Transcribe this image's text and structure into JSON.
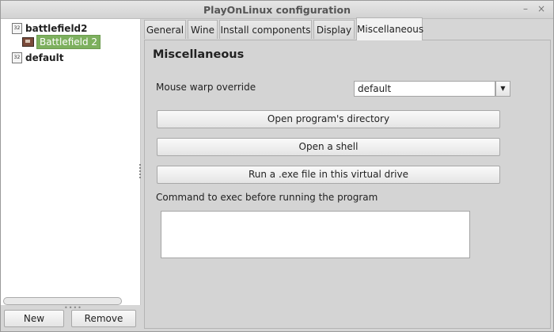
{
  "window": {
    "title": "PlayOnLinux configuration",
    "minimize_glyph": "–",
    "close_glyph": "×"
  },
  "tree": {
    "items": [
      {
        "label": "battlefield2",
        "badge": "32",
        "icon": "bitness-32-icon"
      },
      {
        "label": "Battlefield 2",
        "icon": "game-icon",
        "selected": true
      },
      {
        "label": "default",
        "badge": "32",
        "icon": "bitness-32-icon"
      }
    ]
  },
  "left_buttons": {
    "new": "New",
    "remove": "Remove"
  },
  "tabs": [
    "General",
    "Wine",
    "Install components",
    "Display",
    "Miscellaneous"
  ],
  "active_tab": "Miscellaneous",
  "misc": {
    "heading": "Miscellaneous",
    "mouse_warp_label": "Mouse warp override",
    "mouse_warp_value": "default",
    "open_dir": "Open program's directory",
    "open_shell": "Open a shell",
    "run_exe": "Run a .exe file in this virtual drive",
    "command_label": "Command to exec before running the program",
    "command_value": ""
  },
  "colors": {
    "selection": "#7db05e"
  }
}
